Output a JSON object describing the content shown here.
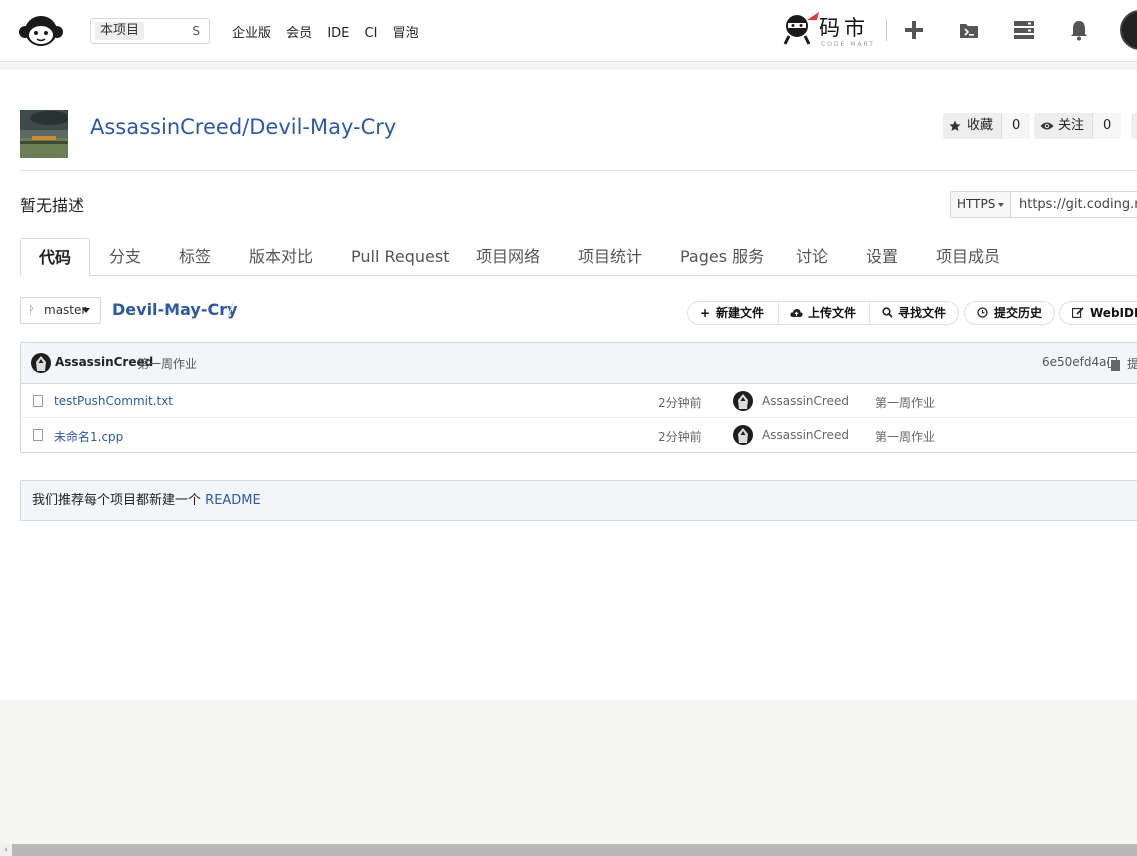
{
  "header": {
    "search_scope": "本项目",
    "search_icon": "S",
    "nav": [
      "企业版",
      "会员",
      "IDE",
      "CI",
      "冒泡"
    ],
    "mart_brand": "码市",
    "mart_sub": "CODE MART",
    "icons": [
      "plus-icon",
      "terminal-icon",
      "server-icon",
      "bell-icon"
    ]
  },
  "repo": {
    "title": "AssassinCreed/Devil-May-Cry",
    "star_label": "收藏",
    "star_count": "0",
    "watch_label": "关注",
    "watch_count": "0",
    "description": "暂无描述",
    "clone_protocol": "HTTPS",
    "clone_url": "https://git.coding.net"
  },
  "tabs": [
    "代码",
    "分支",
    "标签",
    "版本对比",
    "Pull Request",
    "项目网络",
    "项目统计",
    "Pages 服务",
    "讨论",
    "设置",
    "项目成员"
  ],
  "branch": {
    "name": "master",
    "crumb": "Devil-May-Cry",
    "crumb_sep": "/"
  },
  "actions": {
    "new_file": "新建文件",
    "upload_file": "上传文件",
    "find_file": "寻找文件",
    "history": "提交历史",
    "webide": "WebIDE"
  },
  "latest_commit": {
    "author": "AssassinCreed",
    "message": "第一周作业",
    "sha": "6e50efd4ac",
    "trail": "提"
  },
  "files": [
    {
      "name": "testPushCommit.txt",
      "time": "2分钟前",
      "author": "AssassinCreed",
      "message": "第一周作业"
    },
    {
      "name": "未命名1.cpp",
      "time": "2分钟前",
      "author": "AssassinCreed",
      "message": "第一周作业"
    }
  ],
  "readme": {
    "text": "我们推荐每个项目都新建一个",
    "link": "README"
  },
  "colors": {
    "link": "#2d5aa0",
    "header_bg": "#ffffff",
    "page_bg": "#f5f5f3",
    "table_head": "#f3f6f9"
  }
}
